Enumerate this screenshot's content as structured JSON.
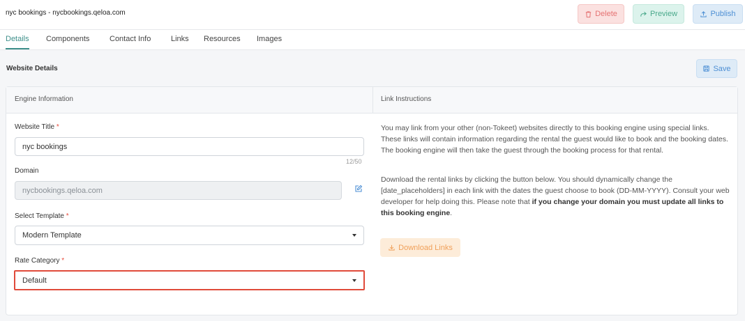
{
  "header": {
    "site_title": "nyc bookings - nycbookings.qeloa.com",
    "delete_label": "Delete",
    "preview_label": "Preview",
    "publish_label": "Publish"
  },
  "tabs": [
    {
      "label": "Details",
      "active": true
    },
    {
      "label": "Components",
      "active": false
    },
    {
      "label": "Contact Info",
      "active": false
    },
    {
      "label": "Links",
      "active": false
    },
    {
      "label": "Resources",
      "active": false
    },
    {
      "label": "Images",
      "active": false
    }
  ],
  "section": {
    "title": "Website Details",
    "save_label": "Save"
  },
  "engine": {
    "heading": "Engine Information",
    "website_title_label": "Website Title",
    "website_title_value": "nyc bookings",
    "website_title_counter": "12/50",
    "domain_label": "Domain",
    "domain_value": "nycbookings.qeloa.com",
    "template_label": "Select Template",
    "template_value": "Modern Template",
    "rate_category_label": "Rate Category",
    "rate_category_value": "Default",
    "required_mark": "*"
  },
  "links": {
    "heading": "Link Instructions",
    "paragraph1": "You may link from your other (non-Tokeet) websites directly to this booking engine using special links. These links will contain information regarding the rental the guest would like to book and the booking dates. The booking engine will then take the guest through the booking process for that rental.",
    "paragraph2_start": "Download the rental links by clicking the button below. You should dynamically change the [date_placeholders] in each link with the dates the guest choose to book (DD-MM-YYYY). Consult your web developer for help doing this. Please note that ",
    "paragraph2_bold": "if you change your domain you must update all links to this booking engine",
    "paragraph2_end": ".",
    "download_label": "Download Links"
  },
  "colors": {
    "accent": "#3d8f8a",
    "delete": "#e57373",
    "preview": "#4aa98b",
    "publish": "#4d8fd4",
    "download": "#f0a05a",
    "highlight": "#e04a3a"
  }
}
